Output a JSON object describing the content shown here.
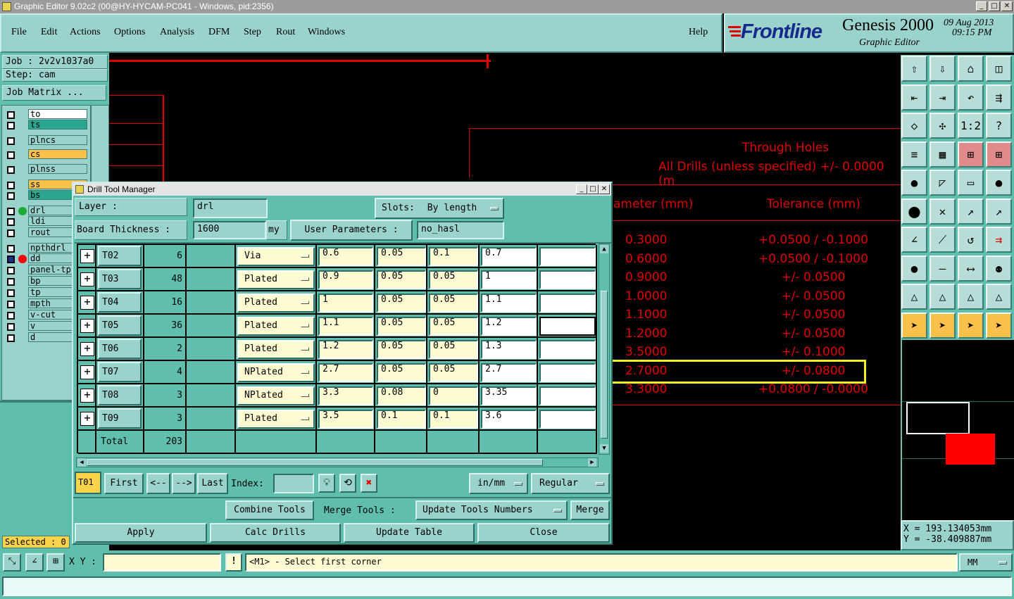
{
  "window": {
    "title": "Graphic Editor 9.02c2 (00@HY-HYCAM-PC041 - Windows, pid:2356)",
    "min": "_",
    "max": "□",
    "close": "✕"
  },
  "menu": {
    "items": [
      "File",
      "Edit",
      "Actions",
      "Options",
      "Analysis",
      "DFM",
      "Step",
      "Rout",
      "Windows"
    ],
    "help": "Help"
  },
  "brand": {
    "logo": "Frontline",
    "product": "Genesis 2000",
    "subtitle": "Graphic Editor",
    "date": "09 Aug 2013",
    "time": "09:15 PM"
  },
  "job": {
    "job": "Job : 2v2v1037a0",
    "step": "Step: cam",
    "matrix_button": "Job Matrix ..."
  },
  "layers": [
    {
      "name": "to",
      "color": "#ffffff",
      "active": true
    },
    {
      "name": "ts",
      "color": "#2aa58e"
    },
    {
      "name": "plncs",
      "color": "#9ad2cc"
    },
    {
      "name": "cs",
      "color": "#f9c14a"
    },
    {
      "name": "plnss",
      "color": "#9ad2cc"
    },
    {
      "name": "ss",
      "color": "#f9c14a"
    },
    {
      "name": "bs",
      "color": "#2aa58e"
    },
    {
      "name": "drl",
      "color": "#9ad2cc",
      "mark": "green"
    },
    {
      "name": "ldi",
      "color": "#9ad2cc"
    },
    {
      "name": "rout",
      "color": "#9ad2cc"
    },
    {
      "name": "npthdrl",
      "color": "#9ad2cc"
    },
    {
      "name": "dd",
      "color": "#9ad2cc",
      "mark": "red",
      "checked": true
    },
    {
      "name": "panel-tp",
      "color": "#9ad2cc"
    },
    {
      "name": "bp",
      "color": "#9ad2cc"
    },
    {
      "name": "tp",
      "color": "#9ad2cc"
    },
    {
      "name": "mpth",
      "color": "#9ad2cc"
    },
    {
      "name": "v-cut",
      "color": "#9ad2cc"
    },
    {
      "name": "v",
      "color": "#9ad2cc"
    },
    {
      "name": "d",
      "color": "#9ad2cc"
    }
  ],
  "selected": "Selected : 0",
  "canvas": {
    "heading1": "Through Holes",
    "heading2": "All Drills (unless specified) +/- 0.0000 (m",
    "col1": "ameter (mm)",
    "col2": "Tolerance (mm)",
    "rows": [
      {
        "d": "0.3000",
        "t": "+0.0500 / -0.1000"
      },
      {
        "d": "0.6000",
        "t": "+0.0500 / -0.1000"
      },
      {
        "d": "0.9000",
        "t": "+/- 0.0500"
      },
      {
        "d": "1.0000",
        "t": "+/- 0.0500"
      },
      {
        "d": "1.1000",
        "t": "+/- 0.0500"
      },
      {
        "d": "1.2000",
        "t": "+/- 0.0500"
      },
      {
        "d": "3.5000",
        "t": "+/- 0.1000"
      },
      {
        "d": "2.7000",
        "t": "+/- 0.0800"
      },
      {
        "d": "3.3000",
        "t": "+0.0800 / -0.0000"
      }
    ]
  },
  "toolbar_icons": [
    "page-up-icon",
    "page-down-icon",
    "home-icon",
    "split-view-icon",
    "import-icon",
    "export-icon",
    "undo-icon",
    "snap-icon",
    "fit-icon",
    "zoom-center-icon",
    "scale-1-2-icon",
    "question-icon",
    "layers-icon",
    "grid-icon",
    "net-icon",
    "net-active-icon",
    "circle-icon",
    "edit-shape-icon",
    "ruler-icon",
    "point-icon",
    "connect-icon",
    "cross-icon",
    "move-icon",
    "move2-icon",
    "angle-icon",
    "line-icon",
    "arc-icon",
    "arrange-icon",
    "point-add-icon",
    "horizontal-icon",
    "measure-icon",
    "group-icon",
    "triangle-icon",
    "triangle2-icon",
    "triangle3-icon",
    "triangle4-icon",
    "pointer-icon",
    "pointer-select-icon",
    "pointer-sel2-icon",
    "pointer-node-icon"
  ],
  "toolbar_icon_glyphs": [
    "⇧",
    "⇩",
    "⌂",
    "◫",
    "⇤",
    "⇥",
    "↶",
    "⇶",
    "◇",
    "✣",
    "1:2",
    "?",
    "≡",
    "▦",
    "⊞",
    "⊞",
    "●",
    "◸",
    "▭",
    "●",
    "⬤",
    "✕",
    "↗",
    "↗",
    "∠",
    "⟋",
    "↺",
    "⇉",
    "●",
    "—",
    "⟷",
    "⚉",
    "△",
    "△",
    "△",
    "△",
    "➤",
    "➤",
    "➤",
    "➤"
  ],
  "coords": {
    "x": "X =  193.134053mm",
    "y": "Y =  -38.409887mm"
  },
  "dialog": {
    "title": "Drill Tool Manager",
    "layer_label": "Layer          :",
    "layer_value": "drl",
    "slots_label": "Slots:",
    "slots_value": "By length",
    "board_label": "Board Thickness  :",
    "board_value": "1600",
    "board_unit": "my",
    "userparams_label": "User Parameters  :",
    "userparams_value": "no_hasl",
    "tools": [
      {
        "name": "T02",
        "count": "6",
        "type": "Via",
        "a": "0.6",
        "b": "0.05",
        "c": "0.1",
        "d": "0.7",
        "e": ""
      },
      {
        "name": "T03",
        "count": "48",
        "type": "Plated",
        "a": "0.9",
        "b": "0.05",
        "c": "0.05",
        "d": "1",
        "e": ""
      },
      {
        "name": "T04",
        "count": "16",
        "type": "Plated",
        "a": "1",
        "b": "0.05",
        "c": "0.05",
        "d": "1.1",
        "e": ""
      },
      {
        "name": "T05",
        "count": "36",
        "type": "Plated",
        "a": "1.1",
        "b": "0.05",
        "c": "0.05",
        "d": "1.2",
        "e": ""
      },
      {
        "name": "T06",
        "count": "2",
        "type": "Plated",
        "a": "1.2",
        "b": "0.05",
        "c": "0.05",
        "d": "1.3",
        "e": ""
      },
      {
        "name": "T07",
        "count": "4",
        "type": "NPlated",
        "a": "2.7",
        "b": "0.05",
        "c": "0.05",
        "d": "2.7",
        "e": ""
      },
      {
        "name": "T08",
        "count": "3",
        "type": "NPlated",
        "a": "3.3",
        "b": "0.08",
        "c": "0",
        "d": "3.35",
        "e": ""
      },
      {
        "name": "T09",
        "count": "3",
        "type": "Plated",
        "a": "3.5",
        "b": "0.1",
        "c": "0.1",
        "d": "3.6",
        "e": ""
      }
    ],
    "total_label": "Total",
    "total_value": "203",
    "current_tool": "T01",
    "nav": {
      "first": "First",
      "prev": "<--",
      "next": "-->",
      "last": "Last",
      "index": "Index:"
    },
    "units": "in/mm",
    "mode": "Regular",
    "combine": "Combine Tools",
    "merge_label": "Merge Tools :",
    "merge_option": "Update Tools Numbers",
    "merge_btn": "Merge",
    "apply": "Apply",
    "calc": "Calc Drills",
    "update": "Update Table",
    "close": "Close"
  },
  "xy": {
    "label": "X Y :",
    "value": "",
    "message": "<M1> - Select first corner",
    "unit": "MM"
  }
}
